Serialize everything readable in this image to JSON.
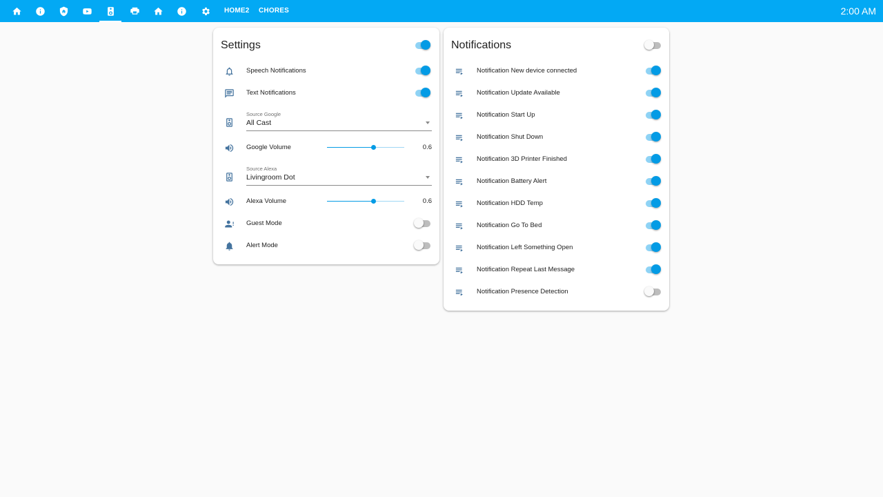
{
  "topbar": {
    "tabs": [
      {
        "icon": "home-icon"
      },
      {
        "icon": "info-icon"
      },
      {
        "icon": "shield-home-icon"
      },
      {
        "icon": "youtube-icon"
      },
      {
        "icon": "speaker-icon"
      },
      {
        "icon": "printer-3d-icon"
      },
      {
        "icon": "home-icon"
      },
      {
        "icon": "info-icon"
      },
      {
        "icon": "gear-icon"
      }
    ],
    "active_tab": 4,
    "text_tabs": [
      "HOME2",
      "CHORES"
    ],
    "clock": "2:00 AM",
    "accent": "#03a9f4"
  },
  "settings": {
    "title": "Settings",
    "master_toggle": true,
    "speech": {
      "label": "Speech Notifications",
      "on": true,
      "icon": "bell-outline-icon"
    },
    "text": {
      "label": "Text Notifications",
      "on": true,
      "icon": "message-text-icon"
    },
    "source_google": {
      "caption": "Source Google",
      "value": "All Cast",
      "icon": "speaker-icon"
    },
    "google_volume": {
      "label": "Google Volume",
      "value": "0.6",
      "level": 0.6,
      "icon": "volume-icon"
    },
    "source_alexa": {
      "caption": "Source Alexa",
      "value": "Livingroom Dot",
      "icon": "speaker-icon"
    },
    "alexa_volume": {
      "label": "Alexa Volume",
      "value": "0.6",
      "level": 0.6,
      "icon": "volume-icon"
    },
    "guest": {
      "label": "Guest Mode",
      "on": false,
      "icon": "account-alert-icon"
    },
    "alert": {
      "label": "Alert Mode",
      "on": false,
      "icon": "bell-icon"
    }
  },
  "notifications": {
    "title": "Notifications",
    "master_toggle": false,
    "items": [
      {
        "label": "Notification New device connected",
        "on": true
      },
      {
        "label": "Notification Update Available",
        "on": true
      },
      {
        "label": "Notification Start Up",
        "on": true
      },
      {
        "label": "Notification Shut Down",
        "on": true
      },
      {
        "label": "Notification 3D Printer Finished",
        "on": true
      },
      {
        "label": "Notification Battery Alert",
        "on": true
      },
      {
        "label": "Notification HDD Temp",
        "on": true
      },
      {
        "label": "Notification Go To Bed",
        "on": true
      },
      {
        "label": "Notification Left Something Open",
        "on": true
      },
      {
        "label": "Notification Repeat Last Message",
        "on": true
      },
      {
        "label": "Notification Presence Detection",
        "on": false
      }
    ]
  }
}
